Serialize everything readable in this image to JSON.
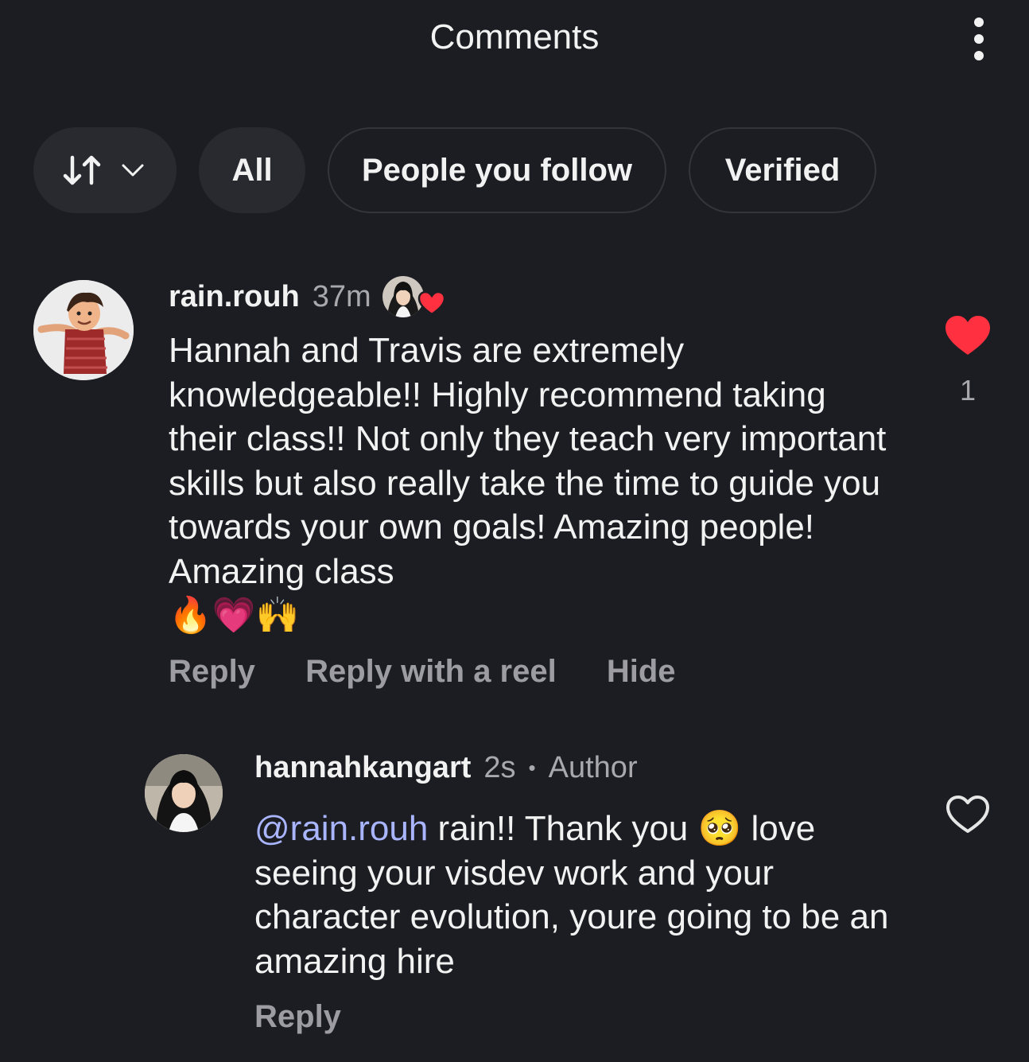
{
  "header": {
    "title": "Comments"
  },
  "filters": {
    "all_label": "All",
    "people_you_follow_label": "People you follow",
    "verified_label": "Verified"
  },
  "comments": [
    {
      "username": "rain.rouh",
      "time": "37m",
      "text": "Hannah and Travis are extremely knowledgeable!! Highly recommend taking their class!! Not only they teach very important skills but also really take the time to guide you towards your own goals! Amazing people! Amazing class",
      "emojis": "🔥💗🙌",
      "liked": true,
      "like_count": "1",
      "actions": {
        "reply": "Reply",
        "reply_with_reel": "Reply with a reel",
        "hide": "Hide"
      }
    }
  ],
  "replies": [
    {
      "username": "hannahkangart",
      "time": "2s",
      "separator": "•",
      "badge": "Author",
      "mention": "@rain.rouh",
      "text_before_emoji": " rain!! Thank you ",
      "emoji": "🥺",
      "text_after_emoji": " love seeing your visdev work and your character evolution, youre going to be an amazing hire",
      "liked": false,
      "actions": {
        "reply": "Reply"
      }
    }
  ],
  "icons": {
    "sort": "sort-arrows-icon",
    "chevron": "chevron-down-icon",
    "more": "more-vertical-icon",
    "heart_filled": "heart-filled-icon",
    "heart_outline": "heart-outline-icon",
    "creator_heart": "creator-liked-icon"
  },
  "colors": {
    "background": "#1c1d22",
    "chip_fill": "#292a30",
    "heart_red": "#ff3040",
    "mention_blue": "#a9b5ff",
    "muted_text": "#9c9ca2"
  }
}
